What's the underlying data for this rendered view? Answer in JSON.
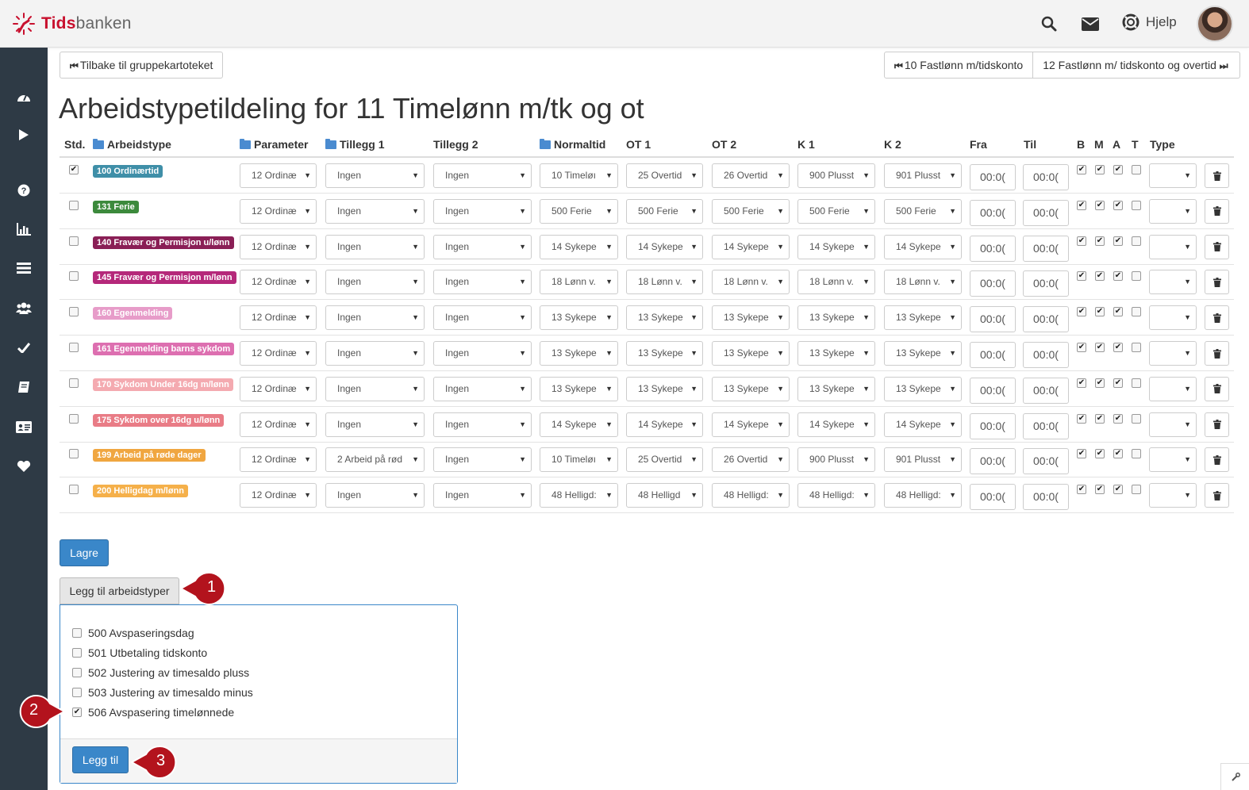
{
  "brand": {
    "name_a": "Tids",
    "name_b": "banken"
  },
  "topnav": {
    "help_label": "Hjelp"
  },
  "nav": {
    "back_label": "Tilbake til gruppekartoteket",
    "prev_label": "10 Fastlønn m/tidskonto",
    "next_label": "12 Fastlønn m/ tidskonto og overtid"
  },
  "page_title": "Arbeidstypetildeling for 11 Timelønn m/tk og ot",
  "columns": {
    "std": "Std.",
    "arbeidstype": "Arbeidstype",
    "parameter": "Parameter",
    "tillegg1": "Tillegg 1",
    "tillegg2": "Tillegg 2",
    "normaltid": "Normaltid",
    "ot1": "OT 1",
    "ot2": "OT 2",
    "k1": "K 1",
    "k2": "K 2",
    "fra": "Fra",
    "til": "Til",
    "b": "B",
    "m": "M",
    "a": "A",
    "t": "T",
    "type": "Type"
  },
  "rows": [
    {
      "std": true,
      "label": "100 Ordinærtid",
      "color": "#3f8fa8",
      "parameter": "12 Ordinæ",
      "tillegg1": "Ingen",
      "tillegg2": "Ingen",
      "normaltid": "10 Timeløı",
      "ot1": "25 Overtid",
      "ot2": "26 Overtid",
      "k1": "900 Plusst",
      "k2": "901 Plusst",
      "fra": "00:0(",
      "til": "00:0(",
      "b": true,
      "m": true,
      "a": true,
      "t": false,
      "type": ""
    },
    {
      "std": false,
      "label": "131 Ferie",
      "color": "#3c8a3c",
      "parameter": "12 Ordinæ",
      "tillegg1": "Ingen",
      "tillegg2": "Ingen",
      "normaltid": "500 Ferie",
      "ot1": "500 Ferie",
      "ot2": "500 Ferie",
      "k1": "500 Ferie",
      "k2": "500 Ferie",
      "fra": "00:0(",
      "til": "00:0(",
      "b": true,
      "m": true,
      "a": true,
      "t": false,
      "type": ""
    },
    {
      "std": false,
      "label": "140 Fravær og Permisjon u/lønn",
      "color": "#8a1f56",
      "parameter": "12 Ordinæ",
      "tillegg1": "Ingen",
      "tillegg2": "Ingen",
      "normaltid": "14 Sykepe",
      "ot1": "14 Sykepe",
      "ot2": "14 Sykepe",
      "k1": "14 Sykepe",
      "k2": "14 Sykepe",
      "fra": "00:0(",
      "til": "00:0(",
      "b": true,
      "m": true,
      "a": true,
      "t": false,
      "type": ""
    },
    {
      "std": false,
      "label": "145 Fravær og Permisjon m/lønn",
      "color": "#b5287a",
      "parameter": "12 Ordinæ",
      "tillegg1": "Ingen",
      "tillegg2": "Ingen",
      "normaltid": "18 Lønn v.",
      "ot1": "18 Lønn v.",
      "ot2": "18 Lønn v.",
      "k1": "18 Lønn v.",
      "k2": "18 Lønn v.",
      "fra": "00:0(",
      "til": "00:0(",
      "b": true,
      "m": true,
      "a": true,
      "t": false,
      "type": ""
    },
    {
      "std": false,
      "label": "160 Egenmelding",
      "color": "#e79cc9",
      "parameter": "12 Ordinæ",
      "tillegg1": "Ingen",
      "tillegg2": "Ingen",
      "normaltid": "13 Sykepe",
      "ot1": "13 Sykepe",
      "ot2": "13 Sykepe",
      "k1": "13 Sykepe",
      "k2": "13 Sykepe",
      "fra": "00:0(",
      "til": "00:0(",
      "b": true,
      "m": true,
      "a": true,
      "t": false,
      "type": ""
    },
    {
      "std": false,
      "label": "161 Egenmelding barns sykdom",
      "color": "#dd6fb0",
      "parameter": "12 Ordinæ",
      "tillegg1": "Ingen",
      "tillegg2": "Ingen",
      "normaltid": "13 Sykepe",
      "ot1": "13 Sykepe",
      "ot2": "13 Sykepe",
      "k1": "13 Sykepe",
      "k2": "13 Sykepe",
      "fra": "00:0(",
      "til": "00:0(",
      "b": true,
      "m": true,
      "a": true,
      "t": false,
      "type": ""
    },
    {
      "std": false,
      "label": "170 Sykdom Under 16dg m/lønn",
      "color": "#f4aab0",
      "parameter": "12 Ordinæ",
      "tillegg1": "Ingen",
      "tillegg2": "Ingen",
      "normaltid": "13 Sykepe",
      "ot1": "13 Sykepe",
      "ot2": "13 Sykepe",
      "k1": "13 Sykepe",
      "k2": "13 Sykepe",
      "fra": "00:0(",
      "til": "00:0(",
      "b": true,
      "m": true,
      "a": true,
      "t": false,
      "type": ""
    },
    {
      "std": false,
      "label": "175 Sykdom over 16dg u/lønn",
      "color": "#e97c86",
      "parameter": "12 Ordinæ",
      "tillegg1": "Ingen",
      "tillegg2": "Ingen",
      "normaltid": "14 Sykepe",
      "ot1": "14 Sykepe",
      "ot2": "14 Sykepe",
      "k1": "14 Sykepe",
      "k2": "14 Sykepe",
      "fra": "00:0(",
      "til": "00:0(",
      "b": true,
      "m": true,
      "a": true,
      "t": false,
      "type": ""
    },
    {
      "std": false,
      "label": "199 Arbeid på røde dager",
      "color": "#f0a640",
      "parameter": "12 Ordinæ",
      "tillegg1": "2 Arbeid på rød",
      "tillegg2": "Ingen",
      "normaltid": "10 Timeløı",
      "ot1": "25 Overtid",
      "ot2": "26 Overtid",
      "k1": "900 Plusst",
      "k2": "901 Plusst",
      "fra": "00:0(",
      "til": "00:0(",
      "b": true,
      "m": true,
      "a": true,
      "t": false,
      "type": ""
    },
    {
      "std": false,
      "label": "200 Helligdag m/lønn",
      "color": "#f5b04a",
      "parameter": "12 Ordinæ",
      "tillegg1": "Ingen",
      "tillegg2": "Ingen",
      "normaltid": "48 Helligd:",
      "ot1": "48 Helligd",
      "ot2": "48 Helligd:",
      "k1": "48 Helligd:",
      "k2": "48 Helligd:",
      "fra": "00:0(",
      "til": "00:0(",
      "b": true,
      "m": true,
      "a": true,
      "t": false,
      "type": ""
    }
  ],
  "save_label": "Lagre",
  "add_types_label": "Legg til arbeidstyper",
  "add_options": [
    {
      "label": "500 Avspaseringsdag",
      "checked": false
    },
    {
      "label": "501 Utbetaling tidskonto",
      "checked": false
    },
    {
      "label": "502 Justering av timesaldo pluss",
      "checked": false
    },
    {
      "label": "503 Justering av timesaldo minus",
      "checked": false
    },
    {
      "label": "506 Avspasering timelønnede",
      "checked": true
    }
  ],
  "add_button_label": "Legg til",
  "callouts": [
    "1",
    "2",
    "3"
  ],
  "colors": {
    "sidebar": "#2e3a45",
    "primary": "#3a87c9",
    "callout": "#b3131d"
  }
}
